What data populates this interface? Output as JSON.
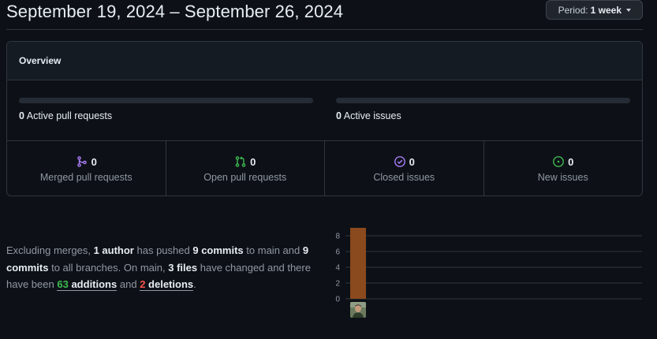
{
  "header": {
    "date_range": "September 19, 2024 – September 26, 2024",
    "period_label": "Period:",
    "period_value": "1 week"
  },
  "overview": {
    "title": "Overview",
    "active_prs_count": "0",
    "active_prs_label": "Active pull requests",
    "active_issues_count": "0",
    "active_issues_label": "Active issues",
    "stats": [
      {
        "count": "0",
        "label": "Merged pull requests",
        "icon": "git-merge-icon",
        "color": "#ab7df8"
      },
      {
        "count": "0",
        "label": "Open pull requests",
        "icon": "git-pull-request-icon",
        "color": "#3fb950"
      },
      {
        "count": "0",
        "label": "Closed issues",
        "icon": "issue-closed-icon",
        "color": "#ab7df8"
      },
      {
        "count": "0",
        "label": "New issues",
        "icon": "issue-opened-icon",
        "color": "#3fb950"
      }
    ]
  },
  "summary": {
    "t1": "Excluding merges,",
    "authors": "1 author",
    "t2": "has pushed",
    "commits_main": "9 commits",
    "t3": "to main and",
    "commits_all": "9 commits",
    "t4": "to all branches. On main,",
    "files": "3 files",
    "t5": "have changed and there have been",
    "additions_num": "63",
    "additions_word": "additions",
    "t6": "and",
    "deletions_num": "2",
    "deletions_word": "deletions",
    "t7": "."
  },
  "chart_data": {
    "type": "bar",
    "categories": [
      "author"
    ],
    "values": [
      9
    ],
    "ylim": [
      0,
      9
    ],
    "yticks": [
      0,
      2,
      4,
      6,
      8
    ],
    "grid": true,
    "bar_color": "#8a4a1d"
  }
}
